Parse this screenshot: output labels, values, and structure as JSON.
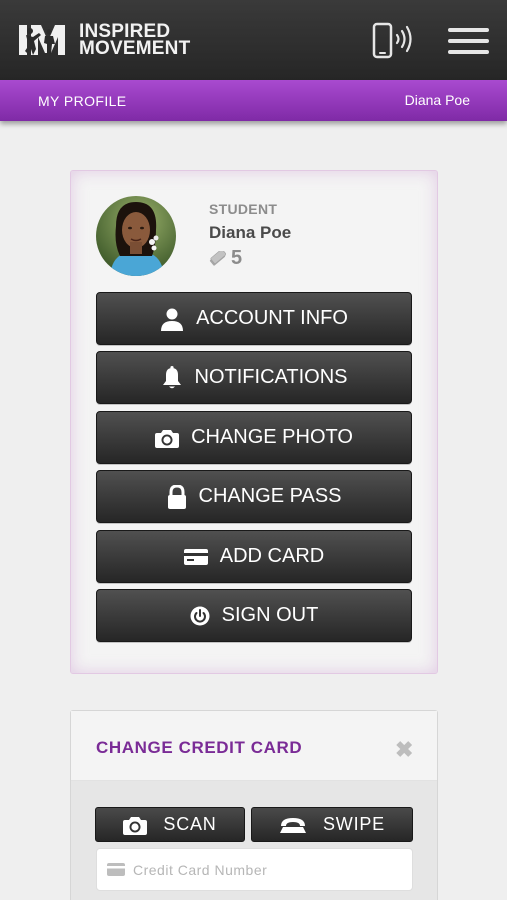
{
  "header": {
    "logo_monogram": "IM",
    "logo_line1": "INSPIRED",
    "logo_line2": "MOVEMENT",
    "phone_icon": "phone-vibrate-icon",
    "menu_icon": "hamburger-menu-icon"
  },
  "subheader": {
    "section_label": "MY PROFILE",
    "user_name": "Diana Poe"
  },
  "profile": {
    "role": "STUDENT",
    "name": "Diana Poe",
    "credits": "5",
    "credits_icon": "ticket-icon"
  },
  "actions": [
    {
      "label": "ACCOUNT INFO",
      "icon": "user-icon"
    },
    {
      "label": "NOTIFICATIONS",
      "icon": "bell-icon"
    },
    {
      "label": "CHANGE PHOTO",
      "icon": "camera-icon"
    },
    {
      "label": "CHANGE PASS",
      "icon": "lock-icon"
    },
    {
      "label": "ADD CARD",
      "icon": "credit-card-icon"
    },
    {
      "label": "SIGN OUT",
      "icon": "power-icon"
    }
  ],
  "credit_card_panel": {
    "title": "CHANGE CREDIT CARD",
    "close_glyph": "✖",
    "scan_label": "SCAN",
    "swipe_label": "SWIPE",
    "card_number_placeholder": "Credit Card Number",
    "card_number_value": ""
  },
  "colors": {
    "accent_purple": "#8e35b8",
    "title_purple": "#7a2b96",
    "header_dark": "#2b2b2b",
    "button_dark": "#333333",
    "background": "#efefef"
  }
}
